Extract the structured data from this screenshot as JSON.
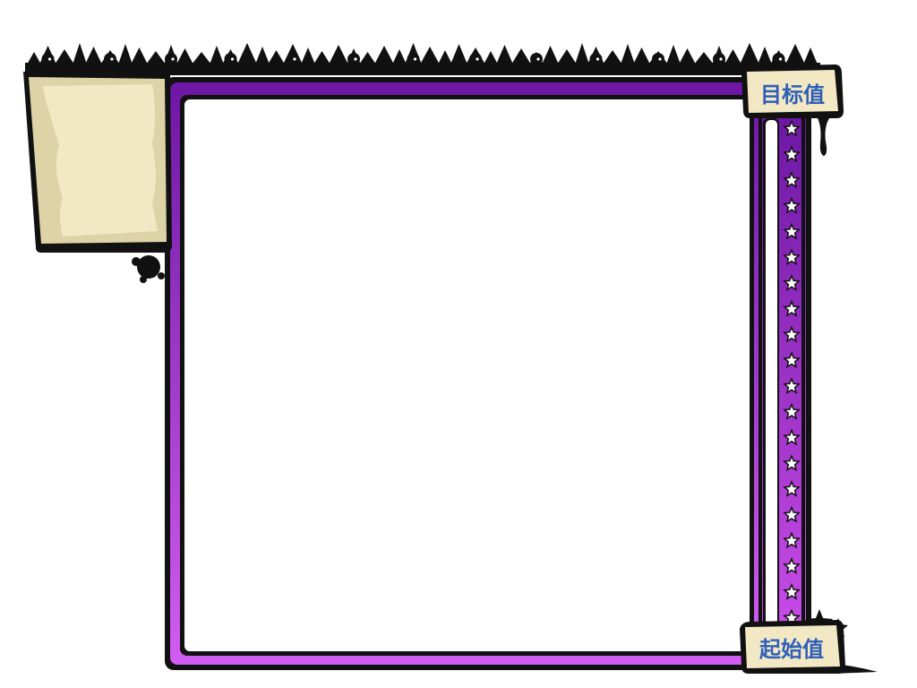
{
  "meter": {
    "top_label": "目标值",
    "bottom_label": "起始值",
    "star_count": 20,
    "fill_fraction": 0
  },
  "colors": {
    "purple_dark": "#7b1fb0",
    "purple_mid": "#a43ce0",
    "purple_light": "#d35cf0",
    "outline": "#111111",
    "parchment": "#f2e8c4",
    "parchment_edge": "#ddd3a6",
    "label_text": "#2f5fb8",
    "panel_bg": "#ffffff"
  },
  "icons": {
    "star": "star-icon",
    "spikes": "spiky-border-decoration",
    "splat": "ink-splat-decoration",
    "note": "parchment-note"
  }
}
